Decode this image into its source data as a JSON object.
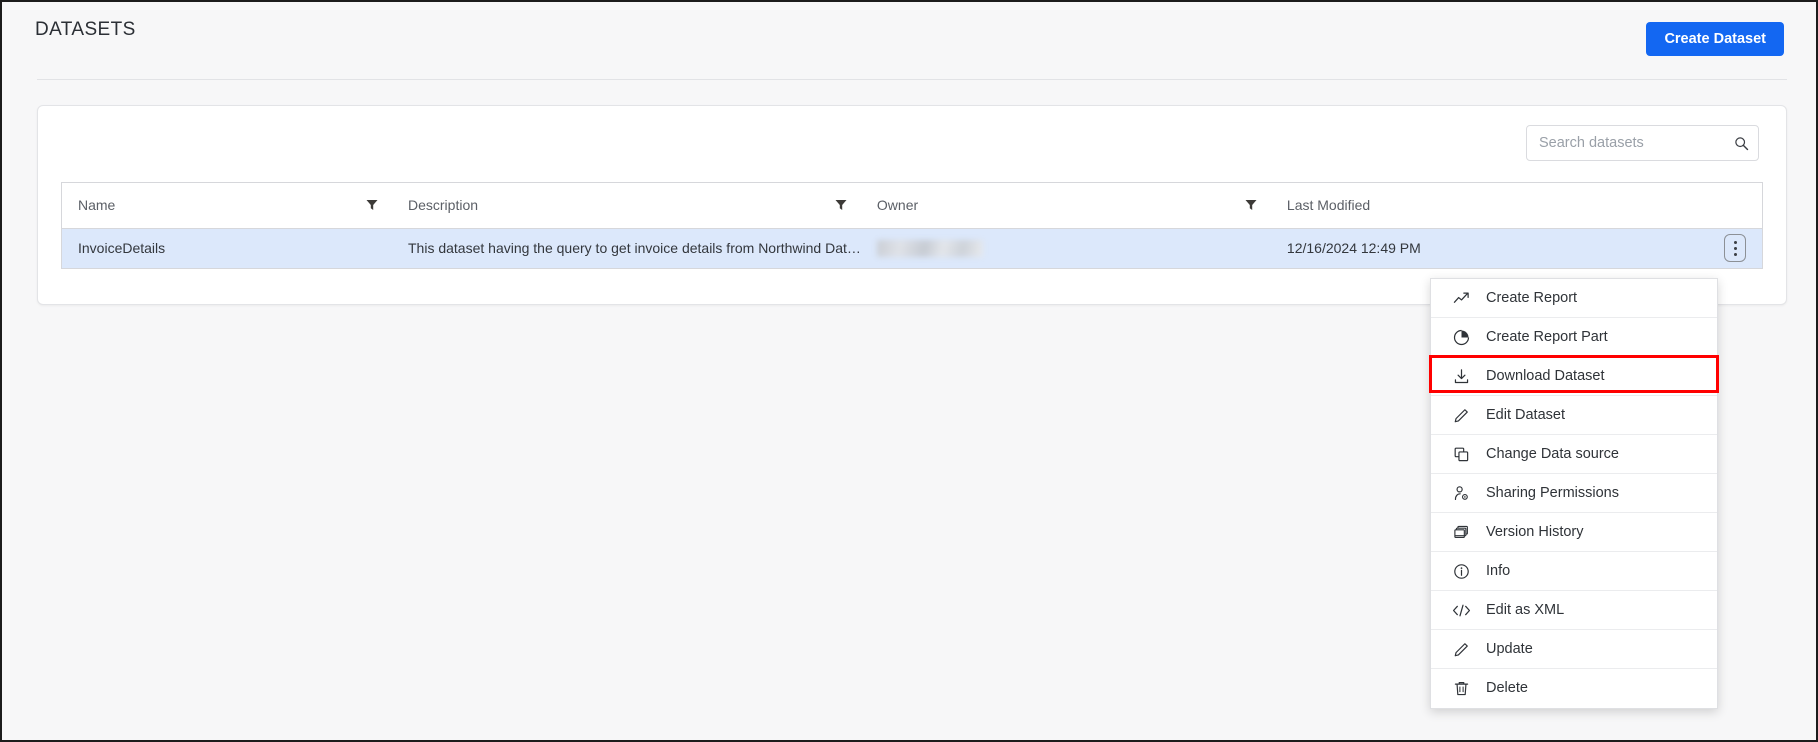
{
  "header": {
    "title": "DATASETS",
    "create_button_label": "Create Dataset"
  },
  "colors": {
    "accent": "#1367f2",
    "row_selected": "#dce8fb",
    "highlight": "#ff0000",
    "page_background": "#f7f7f8"
  },
  "search": {
    "placeholder": "Search datasets",
    "value": "",
    "icon": "search-icon"
  },
  "table": {
    "columns": [
      {
        "label": "Name",
        "filter_icon": "filter-icon"
      },
      {
        "label": "Description",
        "filter_icon": "filter-icon"
      },
      {
        "label": "Owner",
        "filter_icon": "filter-icon"
      },
      {
        "label": "Last Modified",
        "filter_icon": null
      }
    ],
    "rows": [
      {
        "name": "InvoiceDetails",
        "description": "This dataset having the query to get invoice details from Northwind Dat…",
        "owner": "",
        "last_modified": "12/16/2024 12:49 PM",
        "selected": true,
        "actions_icon": "kebab-menu-icon"
      }
    ]
  },
  "context_menu": {
    "highlighted_item": "Download Dataset",
    "items": [
      {
        "label": "Create Report",
        "icon": "trend-line-icon"
      },
      {
        "label": "Create Report Part",
        "icon": "pie-chart-icon"
      },
      {
        "label": "Download Dataset",
        "icon": "download-icon"
      },
      {
        "label": "Edit Dataset",
        "icon": "pencil-icon"
      },
      {
        "label": "Change Data source",
        "icon": "copy-icon"
      },
      {
        "label": "Sharing Permissions",
        "icon": "person-gear-icon"
      },
      {
        "label": "Version History",
        "icon": "stacked-windows-icon"
      },
      {
        "label": "Info",
        "icon": "info-circle-icon"
      },
      {
        "label": "Edit as XML",
        "icon": "code-brackets-icon"
      },
      {
        "label": "Update",
        "icon": "pencil-icon"
      },
      {
        "label": "Delete",
        "icon": "trash-icon"
      }
    ]
  }
}
